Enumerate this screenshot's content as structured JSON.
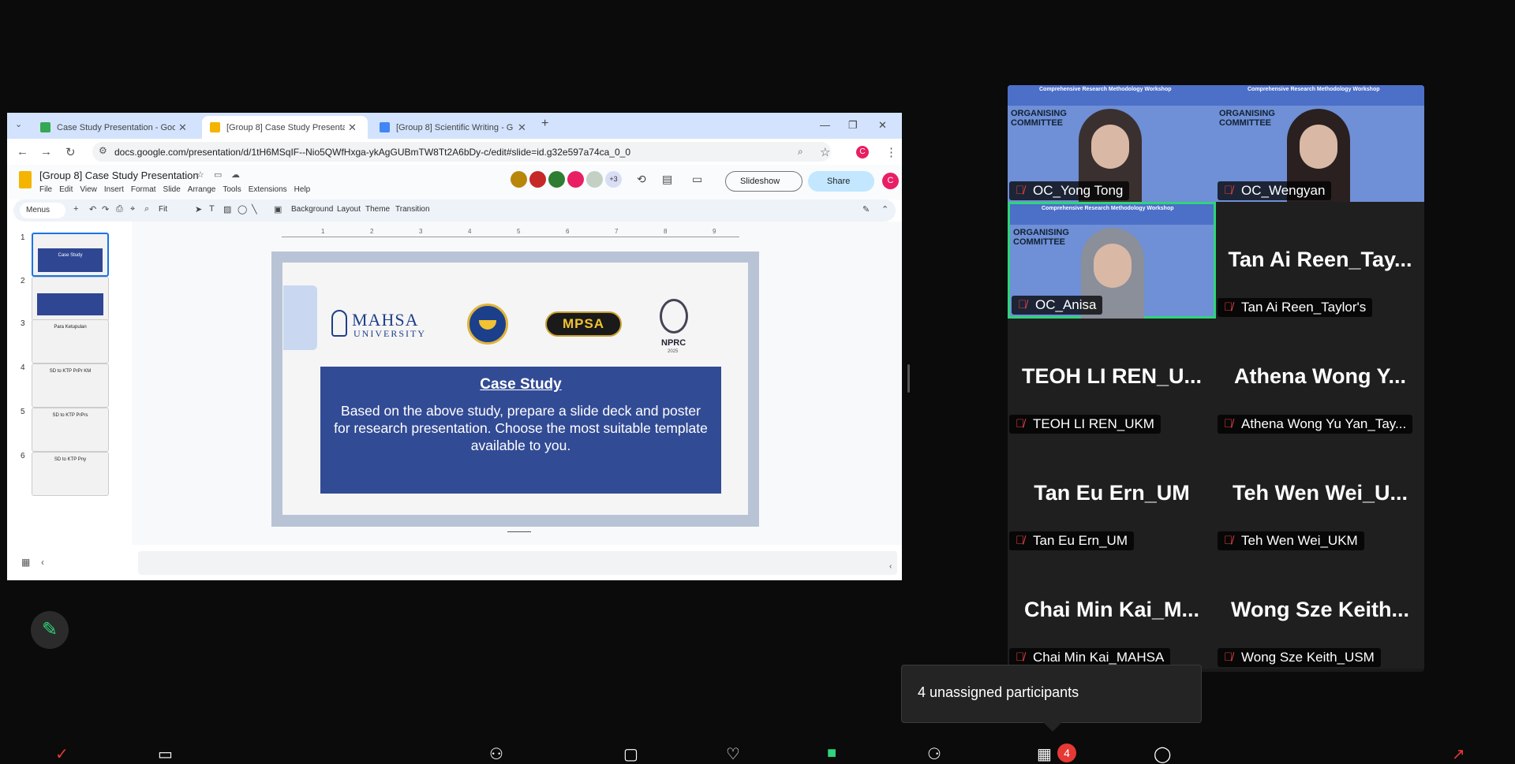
{
  "browser": {
    "tabs": [
      {
        "title": "Case Study Presentation - Goo",
        "color": "#34a853"
      },
      {
        "title": "[Group 8] Case Study Presentati",
        "color": "#f4b400"
      },
      {
        "title": "[Group 8] Scientific Writing - G",
        "color": "#4285f4"
      }
    ],
    "url": "docs.google.com/presentation/d/1tH6MSqIF--Nio5QWfHxga-ykAgGUBmTW8Tt2A6bDy-c/edit#slide=id.g32e597a74ca_0_0"
  },
  "slides": {
    "doc_title": "[Group 8] Case Study Presentation",
    "menu": [
      "File",
      "Edit",
      "View",
      "Insert",
      "Format",
      "Slide",
      "Arrange",
      "Tools",
      "Extensions",
      "Help"
    ],
    "collab_more": "+3",
    "slideshow_label": "Slideshow",
    "share_label": "Share",
    "user_initial": "C",
    "toolbar": {
      "menus_label": "Menus",
      "zoom": "Fit",
      "background": "Background",
      "layout": "Layout",
      "theme": "Theme",
      "transition": "Transition"
    },
    "ruler": [
      "1",
      "2",
      "3",
      "4",
      "5",
      "6",
      "7",
      "8",
      "9"
    ],
    "thumbnails": [
      {
        "num": "1",
        "text": "Case Study"
      },
      {
        "num": "2",
        "text": ""
      },
      {
        "num": "3",
        "text": "Para Ketupulan"
      },
      {
        "num": "4",
        "text": "SD to KTP PrPr KM"
      },
      {
        "num": "5",
        "text": "SD to KTP PrPrs"
      },
      {
        "num": "6",
        "text": "SD to KTP Pny"
      }
    ],
    "current_slide": {
      "logo_mahsa": "MAHSA",
      "logo_mahsa_sub": "UNIVERSITY",
      "logo_mpsa": "MPSA",
      "logo_nprc": "NPRC",
      "logo_nprc_year": "2025",
      "title": "Case Study",
      "body": "Based on the above study, prepare a slide deck and poster for research presentation. Choose the most suitable template available to you."
    }
  },
  "meeting": {
    "video_banner": "Comprehensive Research Methodology Workshop",
    "side_banner": "ORGANISING COMMITTEE",
    "participants": [
      {
        "name": "OC_Yong Tong",
        "video": true
      },
      {
        "name": "OC_Wengyan",
        "video": true
      },
      {
        "name": "OC_Anisa",
        "video": true,
        "active": true
      },
      {
        "name": "Tan Ai Reen_Taylor's",
        "display": "Tan Ai Reen_Tay..."
      },
      {
        "name": "TEOH LI REN_UKM",
        "display": "TEOH LI REN_U..."
      },
      {
        "name": "Athena Wong Yu Yan_Tay...",
        "display": "Athena Wong Y..."
      },
      {
        "name": "Tan Eu Ern_UM",
        "display": "Tan Eu Ern_UM"
      },
      {
        "name": "Teh Wen Wei_UKM",
        "display": "Teh Wen Wei_U..."
      },
      {
        "name": "Chai Min Kai_MAHSA",
        "display": "Chai Min Kai_M..."
      },
      {
        "name": "Wong Sze Keith_USM",
        "display": "Wong Sze Keith..."
      }
    ],
    "tooltip": "4 unassigned participants",
    "badge_count": "4"
  },
  "colors": {
    "active_speaker": "#2fd47b",
    "slide_box": "#324b95",
    "tab_bar": "#d3e3fd"
  }
}
